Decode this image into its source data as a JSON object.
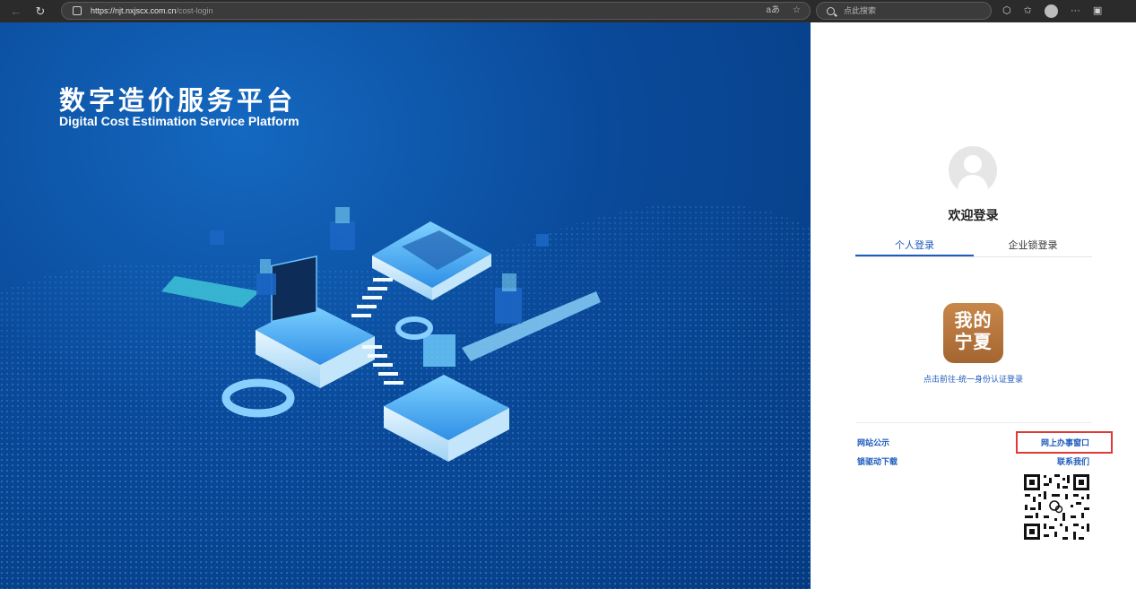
{
  "browser": {
    "url_host": "https://njt.nxjscx.com.cn",
    "url_path": "/cost-login",
    "search_placeholder": "点此搜索",
    "read_aloud_label": "aあ"
  },
  "hero": {
    "title": "数字造价服务平台",
    "subtitle": "Digital Cost Estimation Service Platform"
  },
  "login": {
    "welcome": "欢迎登录",
    "tabs": [
      {
        "label": "个人登录",
        "active": true
      },
      {
        "label": "企业锁登录",
        "active": false
      }
    ],
    "app_icon_lines": [
      "我的",
      "宁夏"
    ],
    "app_link": "点击前往-统一身份认证登录"
  },
  "footer": {
    "notice": "网站公示",
    "driver": "锁驱动下载",
    "online_window": "网上办事窗口",
    "contact": "联系我们"
  },
  "colors": {
    "accent": "#1d5bbd",
    "highlight": "#e0393a",
    "app_icon": "#b8773e"
  }
}
